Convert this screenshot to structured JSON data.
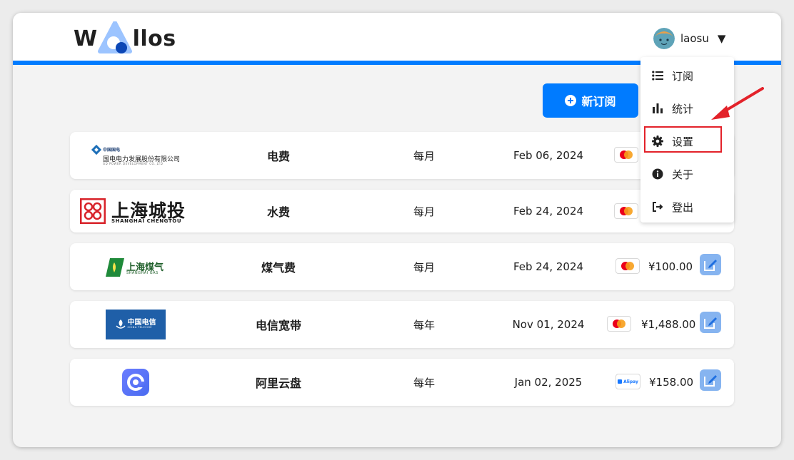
{
  "app": {
    "logo_text_left": "W",
    "logo_text_right": "llos",
    "brand_color": "#007bff"
  },
  "user": {
    "name": "laosu",
    "caret": "▼",
    "avatar_icon": "avatar-icon"
  },
  "toolbar": {
    "new_label": "新订阅"
  },
  "menu": {
    "items": [
      {
        "label": "订阅",
        "icon": "list-icon"
      },
      {
        "label": "统计",
        "icon": "bar-chart-icon"
      },
      {
        "label": "设置",
        "icon": "gear-icon"
      },
      {
        "label": "关于",
        "icon": "info-icon"
      },
      {
        "label": "登出",
        "icon": "logout-icon"
      }
    ],
    "highlighted_index": 2,
    "highlight_color": "#e3222a"
  },
  "subscriptions": [
    {
      "name": "电费",
      "cycle": "每月",
      "date": "Feb 06, 2024",
      "payment": "mastercard-icon",
      "price": "",
      "logo": {
        "type": "sgcc",
        "cn": "国电电力发展股份有限公司",
        "en": "GD POWER DEVELOPMENT CO.,LTD",
        "small": "中国国电"
      }
    },
    {
      "name": "水费",
      "cycle": "每月",
      "date": "Feb 24, 2024",
      "payment": "mastercard-icon",
      "price": "",
      "logo": {
        "type": "chengtou",
        "cn": "上海城投",
        "en": "SHANGHAI CHENGTOU"
      }
    },
    {
      "name": "煤气费",
      "cycle": "每月",
      "date": "Feb 24, 2024",
      "payment": "mastercard-icon",
      "price": "¥100.00",
      "logo": {
        "type": "gas",
        "cn": "上海煤气",
        "en": "SHANGHAI GAS"
      }
    },
    {
      "name": "电信宽带",
      "cycle": "每年",
      "date": "Nov 01, 2024",
      "payment": "mastercard-icon",
      "price": "¥1,488.00",
      "logo": {
        "type": "telecom",
        "cn": "中国电信",
        "en": "CHINA TELECOM"
      }
    },
    {
      "name": "阿里云盘",
      "cycle": "每年",
      "date": "Jan 02, 2025",
      "payment": "alipay-icon",
      "payment_label": "Alipay",
      "price": "¥158.00",
      "logo": {
        "type": "aliyun"
      }
    }
  ]
}
